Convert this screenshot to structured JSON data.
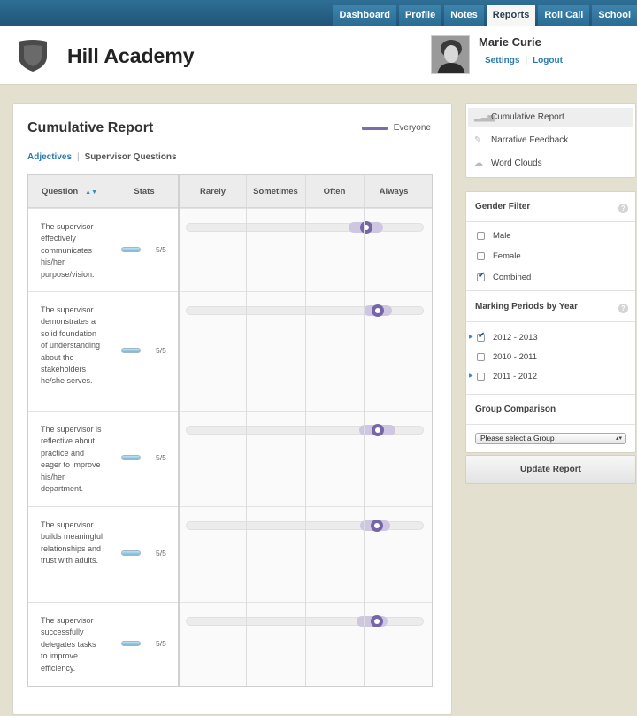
{
  "nav": {
    "tabs": [
      {
        "label": "Dashboard",
        "active": false
      },
      {
        "label": "Profile",
        "active": false
      },
      {
        "label": "Notes",
        "active": false
      },
      {
        "label": "Reports",
        "active": true
      },
      {
        "label": "Roll Call",
        "active": false
      },
      {
        "label": "School",
        "active": false
      }
    ]
  },
  "header": {
    "school_name": "Hill Academy",
    "logo_icon": "shield-icon",
    "user": {
      "name": "Marie Curie",
      "settings_label": "Settings",
      "separator": "|",
      "logout_label": "Logout"
    }
  },
  "report": {
    "title": "Cumulative Report",
    "legend_label": "Everyone",
    "legend_color": "#7b6ea8",
    "subtabs": {
      "adjectives": "Adjectives",
      "separator": "|",
      "supervisor": "Supervisor Questions"
    },
    "columns": {
      "question": "Question",
      "stats": "Stats",
      "rarely": "Rarely",
      "sometimes": "Sometimes",
      "often": "Often",
      "always": "Always"
    },
    "rows": [
      {
        "question": "The supervisor effectively communicates his/her purpose/vision.",
        "score": "5/5"
      },
      {
        "question": "The supervisor demonstrates a solid foundation of understanding about the stakeholders he/she serves.",
        "score": "5/5"
      },
      {
        "question": "The supervisor is reflective about practice and eager to improve his/her department.",
        "score": "5/5"
      },
      {
        "question": "The supervisor builds meaningful relationships and trust with adults.",
        "score": "5/5"
      },
      {
        "question": "The supervisor successfully delegates tasks to improve efficiency.",
        "score": "5/5"
      }
    ]
  },
  "sidebar": {
    "nav": [
      {
        "label": "Cumulative Report",
        "icon": "bar-chart-icon",
        "active": true
      },
      {
        "label": "Narrative Feedback",
        "icon": "pencil-icon",
        "active": false
      },
      {
        "label": "Word Clouds",
        "icon": "cloud-icon",
        "active": false
      }
    ],
    "gender_filter": {
      "title": "Gender Filter",
      "options": [
        {
          "label": "Male",
          "checked": false
        },
        {
          "label": "Female",
          "checked": false
        },
        {
          "label": "Combined",
          "checked": true
        }
      ]
    },
    "marking_periods": {
      "title": "Marking Periods by Year",
      "options": [
        {
          "label": "2012 - 2013",
          "checked": true
        },
        {
          "label": "2010 - 2011",
          "checked": false
        },
        {
          "label": "2011 - 2012",
          "checked": false
        }
      ]
    },
    "group_comparison": {
      "title": "Group Comparison",
      "select_value": "Please select a Group"
    },
    "update_label": "Update Report"
  }
}
